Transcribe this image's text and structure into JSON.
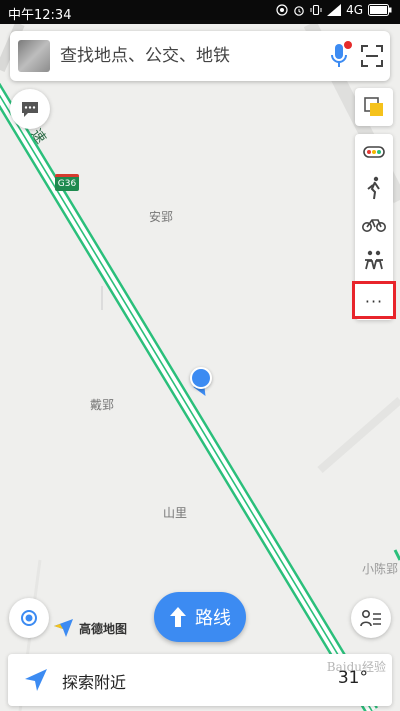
{
  "status_bar": {
    "time": "中午12:34",
    "network": "4G"
  },
  "search": {
    "placeholder": "查找地点、公交、地铁"
  },
  "map": {
    "places": [
      "安郢",
      "戴郢",
      "山里"
    ],
    "road_shield": "G36",
    "partial_labels": [
      "速",
      "小陈郢"
    ]
  },
  "toolbar": {
    "more_label": "···"
  },
  "brand": {
    "name": "高德地图"
  },
  "route_button": {
    "label": "路线"
  },
  "bottom_bar": {
    "explore_label": "探索附近",
    "temperature": "31°"
  },
  "watermark": "Baidu经验",
  "colors": {
    "accent": "#3c8bf2",
    "road": "#2bbf7b",
    "highlight": "#e8242b"
  }
}
